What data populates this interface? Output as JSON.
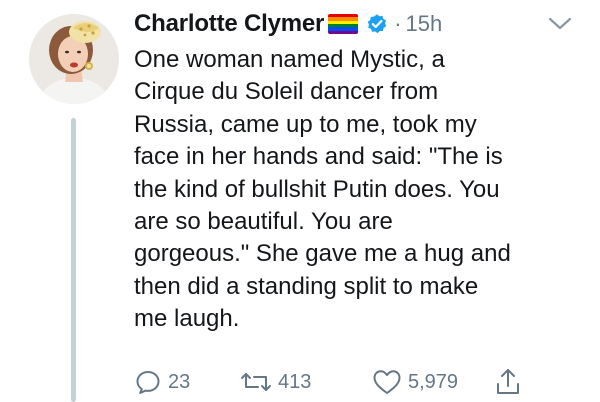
{
  "tweet": {
    "author_name": "Charlotte Clymer",
    "separator": "·",
    "time": "15h",
    "body_lines": [
      "One woman named Mystic, a",
      "Cirque du Soleil dancer from",
      "Russia, came up to me, took my",
      "face in her hands and said: \"The is",
      "the kind of bullshit Putin does. You",
      "are so beautiful. You are",
      "gorgeous.\" She gave me a hug and",
      "then did a standing split to make",
      "me laugh."
    ],
    "reply_count": "23",
    "retweet_count": "413",
    "like_count": "5,979"
  },
  "icons": {
    "flag": "rainbow-flag-icon",
    "verified": "verified-badge-icon",
    "more": "chevron-down-icon",
    "reply": "reply-icon",
    "retweet": "retweet-icon",
    "like": "heart-icon",
    "share": "share-icon"
  },
  "colors": {
    "text": "#14171a",
    "secondary": "#657786",
    "verified": "#1da1f2",
    "thread_line": "#c4cfd6",
    "flag": [
      "#e40303",
      "#ff8c00",
      "#ffed00",
      "#008026",
      "#004dff",
      "#750787"
    ]
  }
}
